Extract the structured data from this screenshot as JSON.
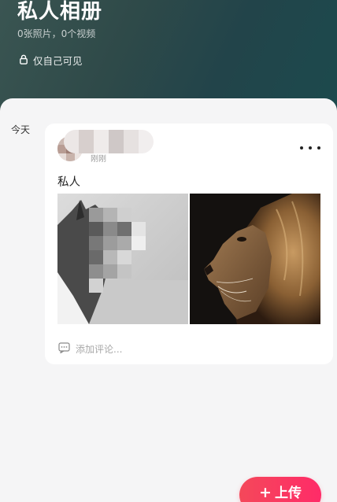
{
  "header": {
    "title": "私人相册",
    "count_text": "0张照片，0个视频",
    "privacy_text": "仅自己可见",
    "privacy_icon": "lock-icon"
  },
  "timeline": {
    "date_label": "今天"
  },
  "post": {
    "author_subtext": "刚刚",
    "more_icon": "more-dots-icon",
    "caption": "私人",
    "photos": [
      {
        "subject": "husky-dog-photo"
      },
      {
        "subject": "lion-profile-photo"
      }
    ],
    "comment_placeholder": "添加评论...",
    "comment_icon": "comment-icon"
  },
  "fab": {
    "plus": "+",
    "label": "上传"
  },
  "colors": {
    "header_start": "#3a5552",
    "header_end": "#1c4a4d",
    "upload_gradient_start": "#f4485a",
    "upload_gradient_end": "#ff2b68"
  }
}
